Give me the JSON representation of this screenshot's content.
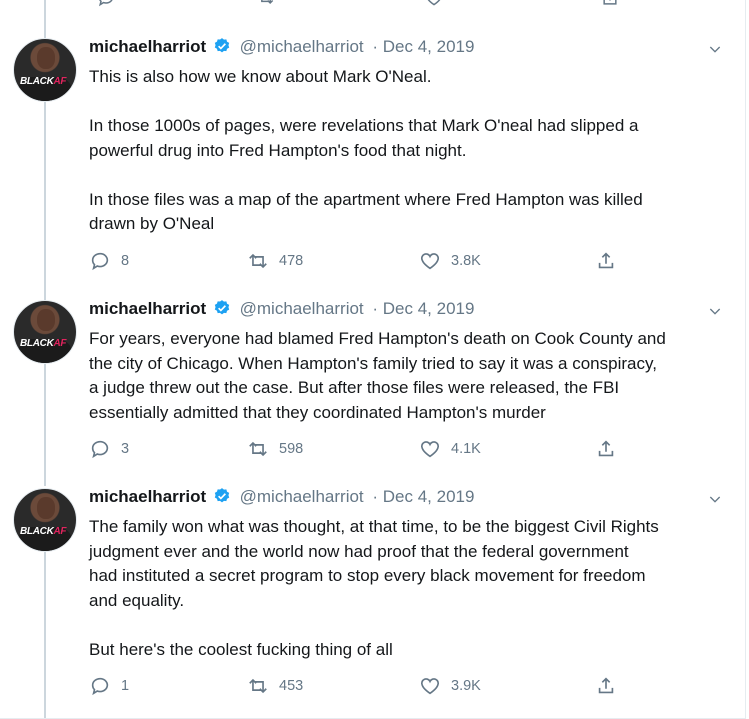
{
  "user": {
    "display_name": "michaelharriot",
    "handle": "@michaelharriot",
    "avatar_brand_main": "BLACK",
    "avatar_brand_suffix": "AF"
  },
  "tweets": [
    {
      "date": "· Dec 4, 2019",
      "text": "This is also how we know about Mark O'Neal.\n\nIn those 1000s of pages, were revelations that Mark O'neal had slipped a\npowerful drug into Fred Hampton's food that night.\n\nIn those files was a map of the apartment where Fred Hampton was killed\ndrawn by O'Neal",
      "replies": "8",
      "retweets": "478",
      "likes": "3.8K"
    },
    {
      "date": "· Dec 4, 2019",
      "text": "For years, everyone had blamed Fred Hampton's death on Cook County and\nthe city of Chicago. When Hampton's family tried to say it was a conspiracy,\na judge threw out the case. But after those files were released, the FBI\nessentially admitted that they coordinated Hampton's murder",
      "replies": "3",
      "retweets": "598",
      "likes": "4.1K"
    },
    {
      "date": "· Dec 4, 2019",
      "text": "The family won what was thought, at that time, to be the biggest Civil Rights\njudgment ever and the world now had proof that the federal government\nhad instituted a secret program to stop every black movement for freedom\nand equality.\n\nBut here's the coolest fucking thing of all",
      "replies": "1",
      "retweets": "453",
      "likes": "3.9K"
    }
  ],
  "colors": {
    "verified": "#1da1f2",
    "secondary_text": "#657786",
    "thread_line": "#ccd6dd"
  },
  "icons": [
    "reply-icon",
    "retweet-icon",
    "like-icon",
    "share-icon",
    "verified-badge-icon",
    "chevron-down-icon"
  ]
}
